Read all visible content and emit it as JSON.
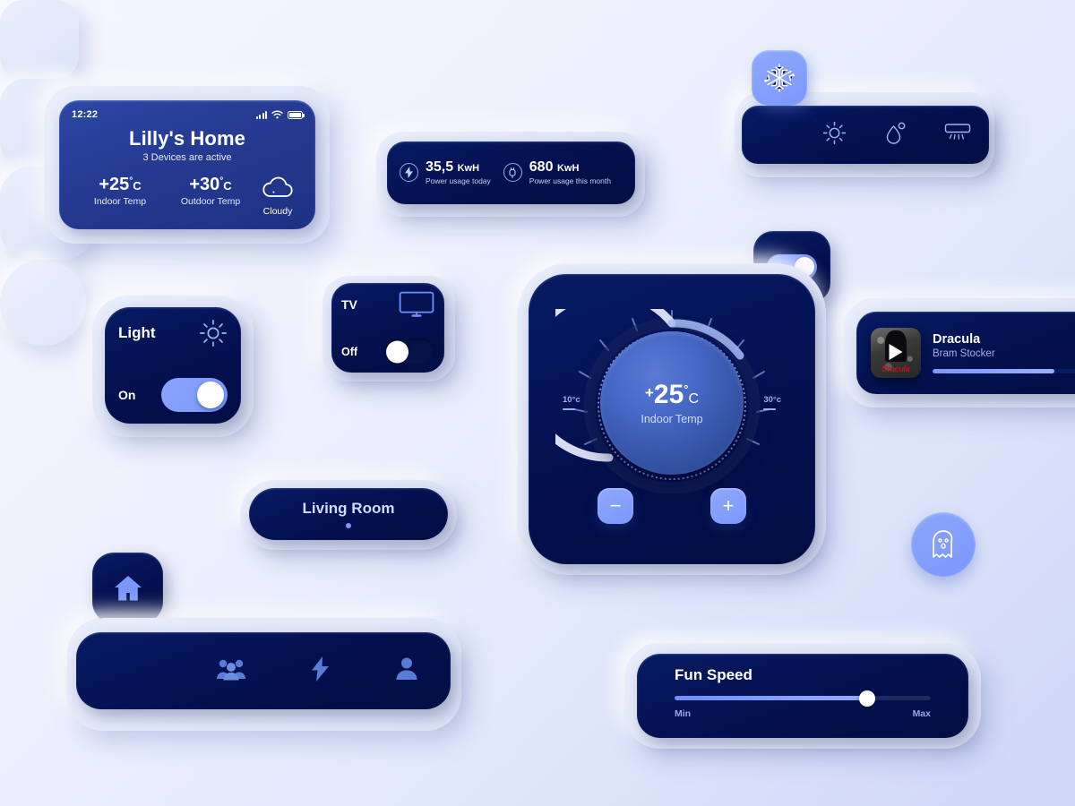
{
  "phone": {
    "status": {
      "time": "12:22",
      "signal_icon": "signal-bars-icon",
      "wifi_icon": "wifi-icon",
      "battery_icon": "battery-icon"
    },
    "title": "Lilly's Home",
    "subtitle": "3 Devices are active",
    "indoor": {
      "sign": "+",
      "value": "25",
      "degree": "°",
      "unit": "C",
      "label": "Indoor Temp"
    },
    "outdoor": {
      "sign": "+",
      "value": "30",
      "degree": "°",
      "unit": "C",
      "label": "Outdoor Temp"
    },
    "weather": {
      "icon": "cloud-icon",
      "label": "Cloudy"
    }
  },
  "power": {
    "today": {
      "icon": "bolt-icon",
      "value": "35,5",
      "unit": "KwH",
      "label": "Power usage today"
    },
    "month": {
      "icon": "plug-icon",
      "value": "680",
      "unit": "KwH",
      "label": "Power usage this month"
    }
  },
  "climate": {
    "active_tile": {
      "icon": "snowflake-icon",
      "name": "cooling"
    },
    "modes": [
      {
        "icon": "sun-icon",
        "name": "heat"
      },
      {
        "icon": "humidity-drop-icon",
        "name": "humidity"
      },
      {
        "icon": "ac-unit-icon",
        "name": "air-conditioner"
      }
    ]
  },
  "floating_toggle": {
    "state": "on"
  },
  "light_card": {
    "title": "Light",
    "icon": "sun-icon",
    "state_label": "On",
    "state": "on"
  },
  "tv_card": {
    "title": "TV",
    "icon": "tv-icon",
    "state_label": "Off",
    "state": "off"
  },
  "thermostat": {
    "value": "25",
    "sign": "+",
    "degree": "°",
    "unit": "C",
    "label": "Indoor Temp",
    "min_label": "10°c",
    "max_label": "30°c",
    "decrease_glyph": "−",
    "increase_glyph": "+",
    "arc_percent": 62
  },
  "living_room": {
    "label": "Living Room"
  },
  "home_tile": {
    "icon": "home-icon"
  },
  "bottom_nav": [
    {
      "icon": "people-group-icon",
      "name": "family"
    },
    {
      "icon": "bolt-icon",
      "name": "energy"
    },
    {
      "icon": "person-icon",
      "name": "profile"
    }
  ],
  "media": {
    "thumb_caption": "Dracula",
    "play_icon": "play-icon",
    "title": "Dracula",
    "author": "Bram Stocker",
    "progress_percent": 72
  },
  "ghost_button": {
    "icon": "ghost-icon"
  },
  "fan": {
    "title": "Fun Speed",
    "min_label": "Min",
    "max_label": "Max",
    "value_percent": 75
  },
  "colors": {
    "dark_navy": "#03104e",
    "card_blue": "#27409c",
    "accent_periwinkle": "#7b97fb",
    "background_light": "#f4f6ff",
    "background_deep": "#ccd6f7"
  }
}
